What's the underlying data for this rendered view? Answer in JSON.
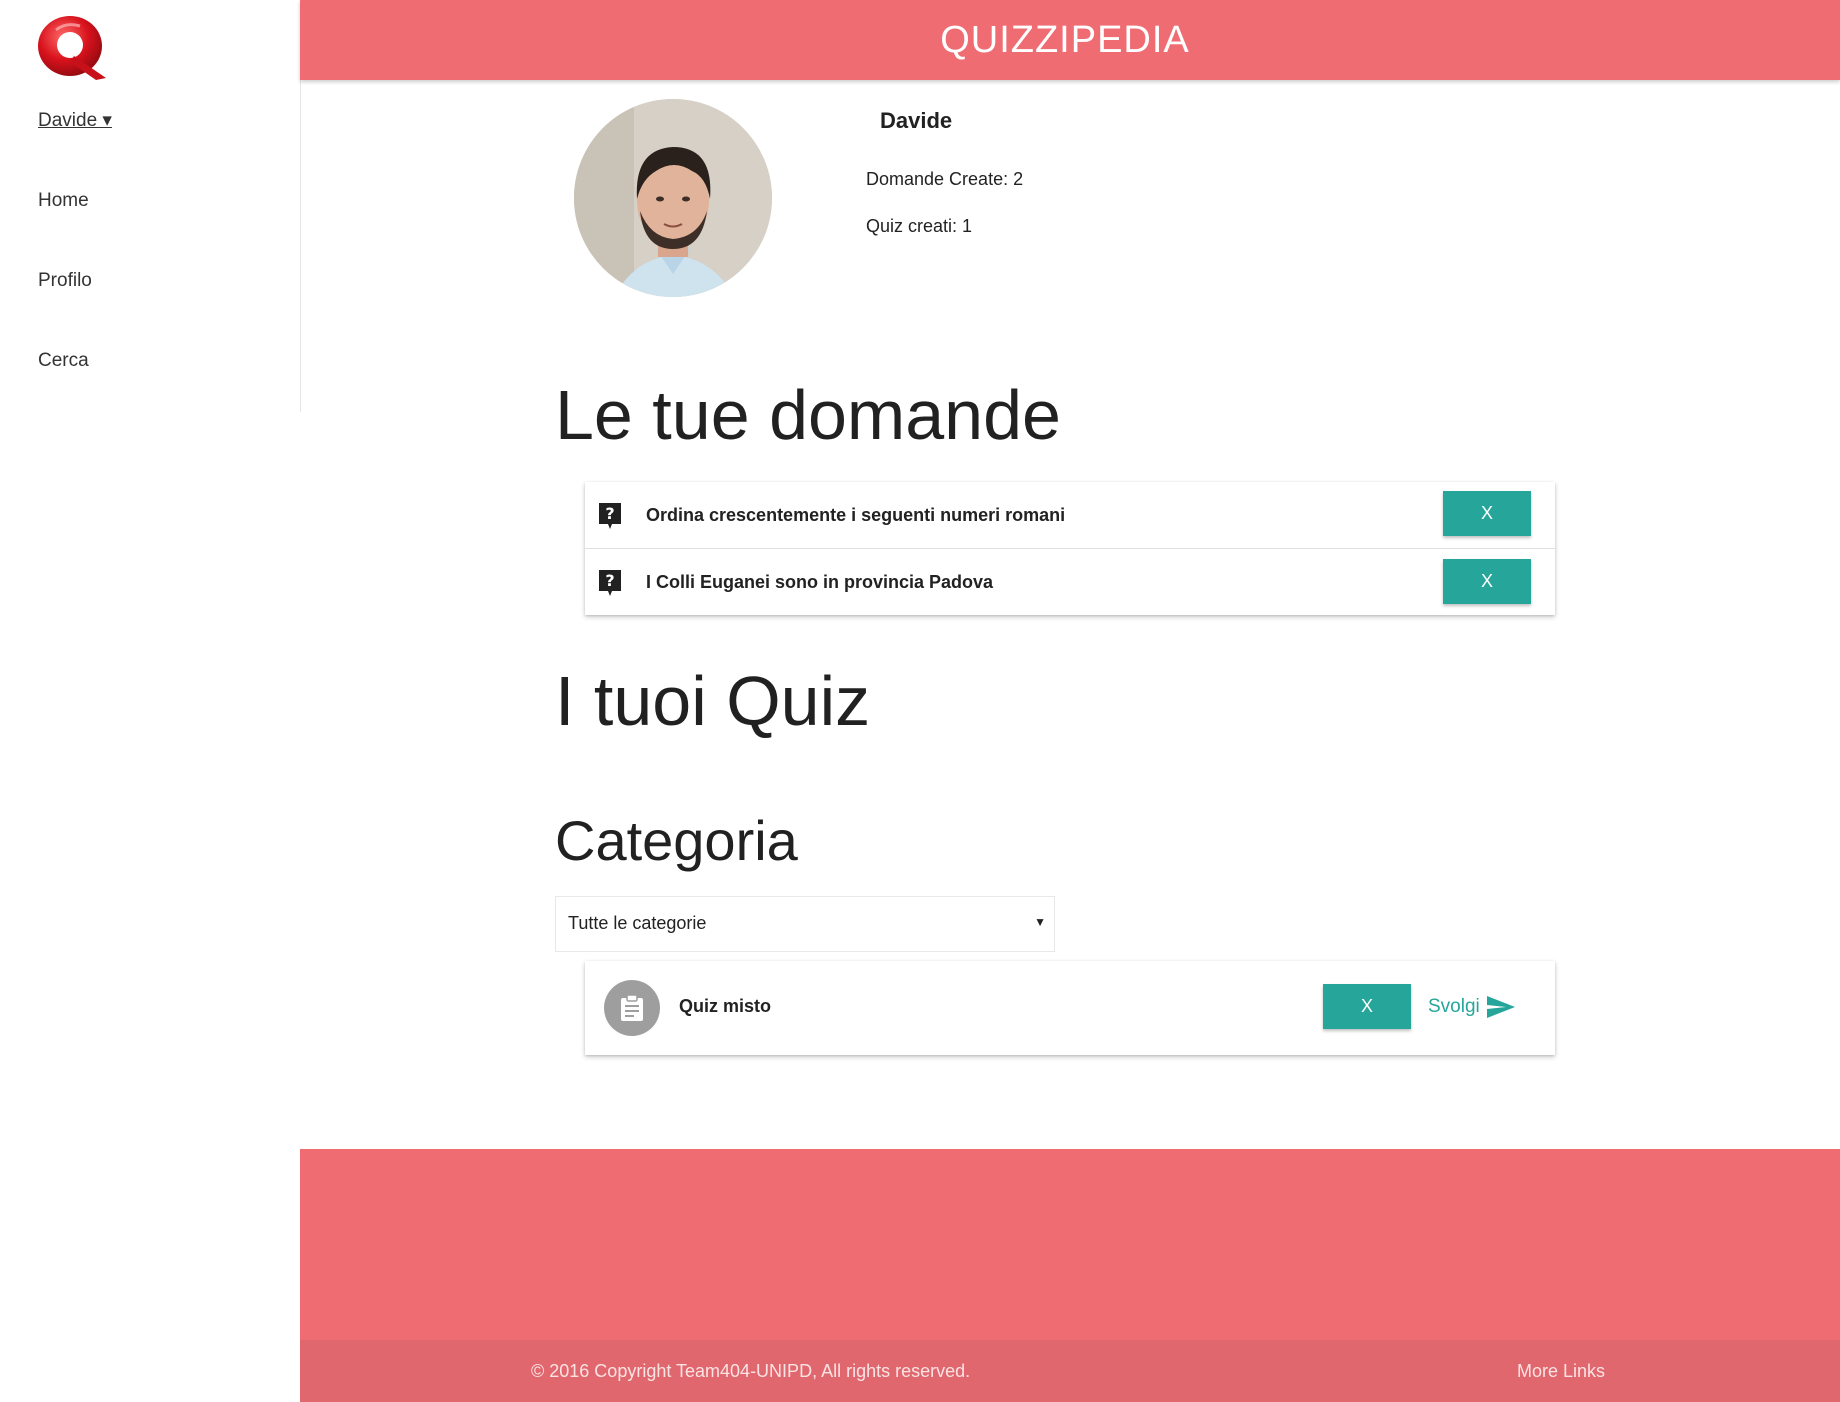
{
  "app": {
    "title": "QUIZZIPEDIA"
  },
  "sidebar": {
    "user_menu": "Davide ▾",
    "items": [
      {
        "label": "Home"
      },
      {
        "label": "Profilo"
      },
      {
        "label": "Cerca"
      }
    ]
  },
  "profile": {
    "name": "Davide",
    "questions_created": "Domande Create: 2",
    "quizzes_created": "Quiz creati: 1"
  },
  "questions_section": {
    "title": "Le tue domande",
    "items": [
      {
        "text": "Ordina crescentemente i seguenti numeri romani",
        "delete_label": "X"
      },
      {
        "text": "I Colli Euganei sono in provincia Padova",
        "delete_label": "X"
      }
    ]
  },
  "quiz_section": {
    "title": "I tuoi Quiz",
    "category_title": "Categoria",
    "category_select": {
      "selected": "Tutte le categorie",
      "caret": "▼"
    },
    "items": [
      {
        "title": "Quiz misto",
        "delete_label": "X",
        "play_label": "Svolgi"
      }
    ]
  },
  "footer": {
    "copyright": "© 2016 Copyright Team404-UNIPD, All rights reserved.",
    "more_links": "More Links"
  },
  "colors": {
    "primary": "#ef6c73",
    "accent": "#26a69a",
    "footer_bar": "#e0676e"
  },
  "icons": {
    "logo": "quizzipedia-q-logo",
    "question": "question-bubble-icon",
    "quiz": "clipboard-icon",
    "send": "send-arrow-icon"
  }
}
